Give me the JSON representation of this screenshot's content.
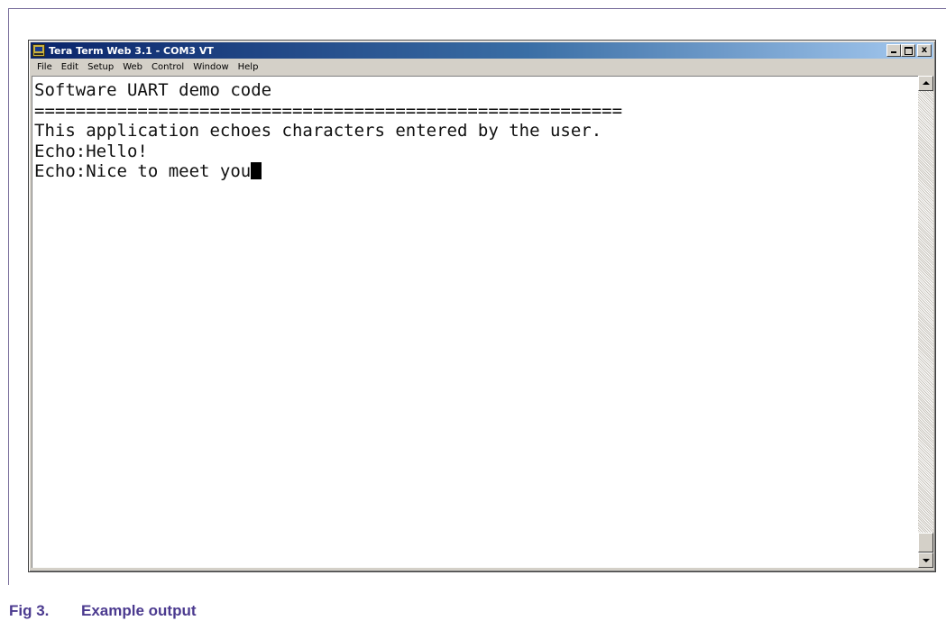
{
  "window": {
    "title": "Tera Term Web 3.1 - COM3 VT",
    "icon": "tera-term-app-icon",
    "buttons": {
      "minimize": "_",
      "maximize": "□",
      "close": "x"
    }
  },
  "menu": {
    "items": [
      {
        "label": "File"
      },
      {
        "label": "Edit"
      },
      {
        "label": "Setup"
      },
      {
        "label": "Web"
      },
      {
        "label": "Control"
      },
      {
        "label": "Window"
      },
      {
        "label": "Help"
      }
    ]
  },
  "terminal": {
    "lines": [
      "Software UART demo code",
      "=========================================================",
      "This application echoes characters entered by the user.",
      "Echo:Hello!",
      "Echo:Nice to meet you"
    ]
  },
  "caption": {
    "figure_number": "Fig 3.",
    "text": "Example output"
  },
  "colors": {
    "caption": "#4b3a8f",
    "titlebar_start": "#0a246a",
    "titlebar_end": "#a6caf0"
  }
}
